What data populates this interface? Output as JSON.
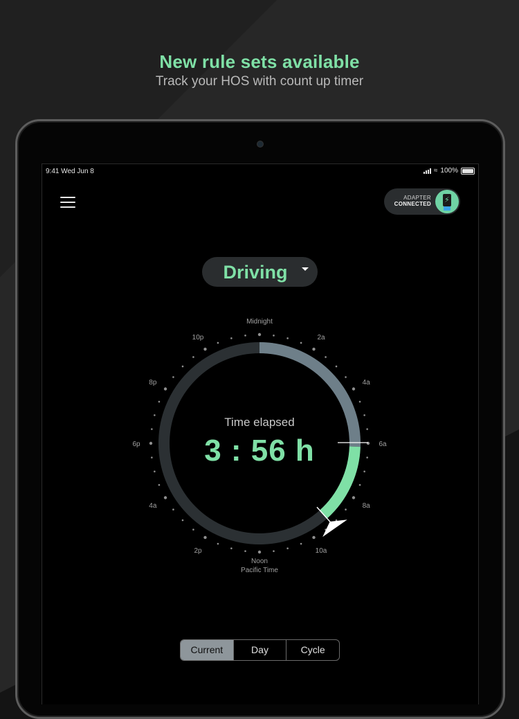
{
  "promo": {
    "title": "New rule sets available",
    "subtitle": "Track your HOS with count up timer"
  },
  "status_bar": {
    "time_date": "9:41  Wed Jun 8",
    "battery": "100%"
  },
  "adapter": {
    "line1": "ADAPTER",
    "line2": "CONNECTED"
  },
  "duty_status": {
    "selected": "Driving"
  },
  "dial": {
    "top_label": "Midnight",
    "bottom_label_1": "Noon",
    "bottom_label_2": "Pacific Time",
    "hour_labels": [
      "2a",
      "4a",
      "6a",
      "8a",
      "10a",
      "2p",
      "4a",
      "6p",
      "8p",
      "10p"
    ],
    "elapsed_label": "Time elapsed",
    "elapsed_value": "3 : 56 h"
  },
  "tabs": [
    "Current",
    "Day",
    "Cycle"
  ],
  "colors": {
    "accent_green": "#7fe0a6",
    "ring_grey_blue": "#6e7f89",
    "ring_track": "#2b3033"
  }
}
